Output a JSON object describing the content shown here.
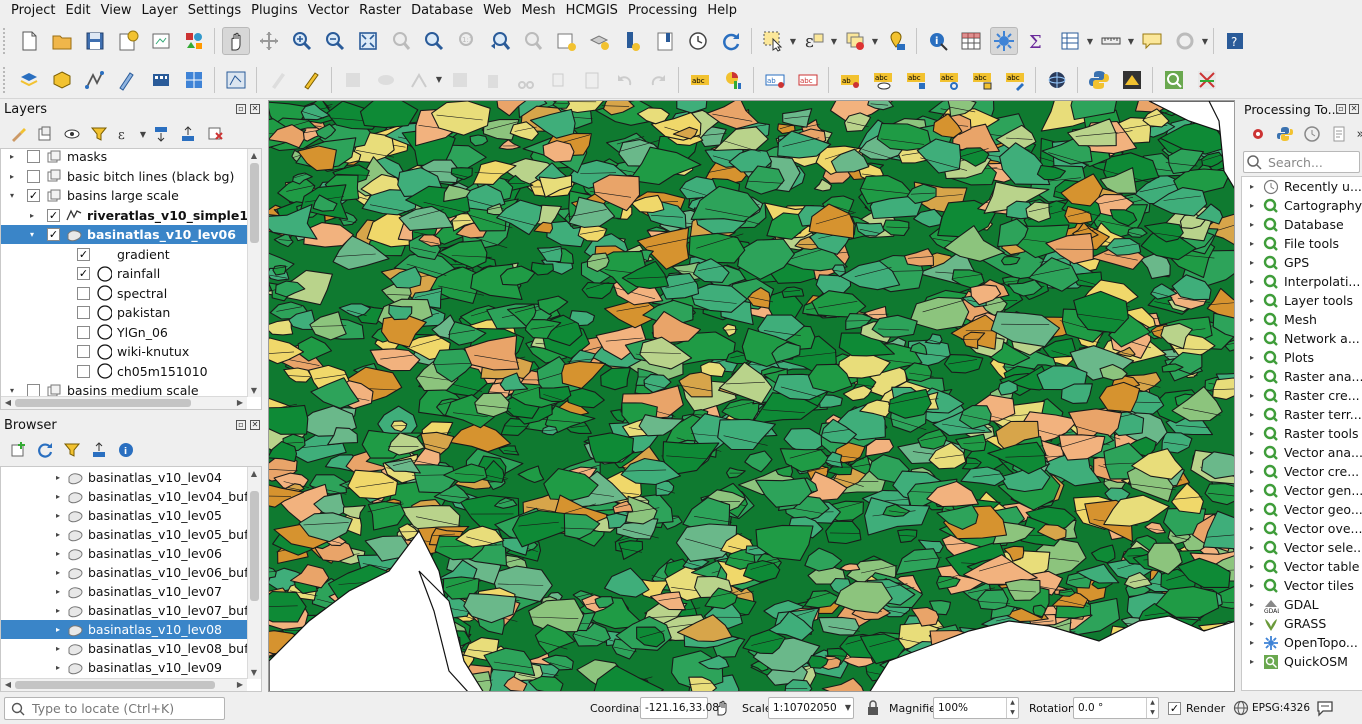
{
  "menu": [
    "Project",
    "Edit",
    "View",
    "Layer",
    "Settings",
    "Plugins",
    "Vector",
    "Raster",
    "Database",
    "Web",
    "Mesh",
    "HCMGIS",
    "Processing",
    "Help"
  ],
  "layers_panel": {
    "title": "Layers",
    "rows": [
      {
        "label": "masks",
        "checked": false,
        "expand": "▸",
        "indent": 0,
        "icon": "group-icon"
      },
      {
        "label": "basic bitch lines (black bg)",
        "checked": false,
        "expand": "▸",
        "indent": 0,
        "icon": "group-icon"
      },
      {
        "label": "basins large scale",
        "checked": true,
        "expand": "▾",
        "indent": 0,
        "icon": "group-icon"
      },
      {
        "label": "riveratlas_v10_simple1",
        "checked": true,
        "expand": "▸",
        "indent": 1,
        "icon": "line-layer-icon",
        "bold": true
      },
      {
        "label": "basinatlas_v10_lev06",
        "checked": true,
        "expand": "▾",
        "indent": 1,
        "icon": "polygon-layer-icon",
        "bold": true,
        "selected": true
      },
      {
        "label": "gradient",
        "checked": true,
        "expand": "",
        "indent": 2,
        "icon": "none"
      },
      {
        "label": "rainfall",
        "checked": true,
        "expand": "",
        "indent": 2,
        "icon": "style-icon"
      },
      {
        "label": "spectral",
        "checked": false,
        "expand": "",
        "indent": 2,
        "icon": "style-icon"
      },
      {
        "label": "pakistan",
        "checked": false,
        "expand": "",
        "indent": 2,
        "icon": "style-icon"
      },
      {
        "label": "YlGn_06",
        "checked": false,
        "expand": "",
        "indent": 2,
        "icon": "style-icon"
      },
      {
        "label": "wiki-knutux",
        "checked": false,
        "expand": "",
        "indent": 2,
        "icon": "style-icon"
      },
      {
        "label": "ch05m151010",
        "checked": false,
        "expand": "",
        "indent": 2,
        "icon": "style-icon"
      },
      {
        "label": "basins medium scale",
        "checked": false,
        "expand": "▾",
        "indent": 0,
        "icon": "group-icon"
      }
    ]
  },
  "browser_panel": {
    "title": "Browser",
    "items": [
      {
        "label": "basinatlas_v10_lev04"
      },
      {
        "label": "basinatlas_v10_lev04_buffer"
      },
      {
        "label": "basinatlas_v10_lev05"
      },
      {
        "label": "basinatlas_v10_lev05_buffer"
      },
      {
        "label": "basinatlas_v10_lev06"
      },
      {
        "label": "basinatlas_v10_lev06_buffer"
      },
      {
        "label": "basinatlas_v10_lev07"
      },
      {
        "label": "basinatlas_v10_lev07_buffer"
      },
      {
        "label": "basinatlas_v10_lev08",
        "selected": true
      },
      {
        "label": "basinatlas_v10_lev08_buffer"
      },
      {
        "label": "basinatlas_v10_lev09"
      }
    ]
  },
  "processing_panel": {
    "title": "Processing To...",
    "search_placeholder": "Search...",
    "items": [
      {
        "label": "Recently u...",
        "icon": "clock-icon"
      },
      {
        "label": "Cartography",
        "icon": "qgis-icon"
      },
      {
        "label": "Database",
        "icon": "qgis-icon"
      },
      {
        "label": "File tools",
        "icon": "qgis-icon"
      },
      {
        "label": "GPS",
        "icon": "qgis-icon"
      },
      {
        "label": "Interpolati...",
        "icon": "qgis-icon"
      },
      {
        "label": "Layer tools",
        "icon": "qgis-icon"
      },
      {
        "label": "Mesh",
        "icon": "qgis-icon"
      },
      {
        "label": "Network a...",
        "icon": "qgis-icon"
      },
      {
        "label": "Plots",
        "icon": "qgis-icon"
      },
      {
        "label": "Raster ana...",
        "icon": "qgis-icon"
      },
      {
        "label": "Raster cre...",
        "icon": "qgis-icon"
      },
      {
        "label": "Raster terr...",
        "icon": "qgis-icon"
      },
      {
        "label": "Raster tools",
        "icon": "qgis-icon"
      },
      {
        "label": "Vector ana...",
        "icon": "qgis-icon"
      },
      {
        "label": "Vector cre...",
        "icon": "qgis-icon"
      },
      {
        "label": "Vector gen...",
        "icon": "qgis-icon"
      },
      {
        "label": "Vector geo...",
        "icon": "qgis-icon"
      },
      {
        "label": "Vector ove...",
        "icon": "qgis-icon"
      },
      {
        "label": "Vector sele...",
        "icon": "qgis-icon"
      },
      {
        "label": "Vector table",
        "icon": "qgis-icon"
      },
      {
        "label": "Vector tiles",
        "icon": "qgis-icon"
      },
      {
        "label": "GDAL",
        "icon": "gdal-icon"
      },
      {
        "label": "GRASS",
        "icon": "grass-icon"
      },
      {
        "label": "OpenTopo...",
        "icon": "gear-icon"
      },
      {
        "label": "QuickOSM",
        "icon": "quickosm-icon"
      }
    ]
  },
  "statusbar": {
    "locate_placeholder": "Type to locate (Ctrl+K)",
    "coordinate_label": "Coordinate",
    "coordinate_value": "-121.16,33.08",
    "scale_label": "Scale",
    "scale_value": "1:10702050",
    "magnifier_label": "Magnifier",
    "magnifier_value": "100%",
    "rotation_label": "Rotation",
    "rotation_value": "0.0 °",
    "render_label": "Render",
    "render_checked": true,
    "crs_label": "EPSG:4326"
  },
  "map_palette": [
    "#0e8a36",
    "#1f9b45",
    "#2da35a",
    "#3fae7a",
    "#6ab88a",
    "#8cc47d",
    "#b9d38b",
    "#e8dd7a",
    "#f0d86a",
    "#d7a54a",
    "#e9a469",
    "#f2b27e",
    "#d6932f"
  ]
}
